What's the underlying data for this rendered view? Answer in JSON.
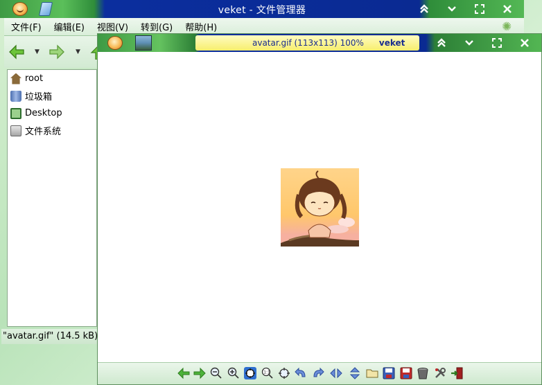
{
  "file_manager": {
    "title": "veket - 文件管理器",
    "menu": [
      "文件(F)",
      "编辑(E)",
      "视图(V)",
      "转到(G)",
      "帮助(H)"
    ],
    "sidebar": [
      {
        "label": "root",
        "icon": "home-icon"
      },
      {
        "label": "垃圾箱",
        "icon": "trash-icon"
      },
      {
        "label": "Desktop",
        "icon": "desktop-icon"
      },
      {
        "label": "文件系统",
        "icon": "filesystem-icon"
      }
    ],
    "status": "\"avatar.gif\" (14.5 kB)"
  },
  "image_viewer": {
    "caption_file": "avatar.gif  (113x113)  100%",
    "caption_user": "veket",
    "toolbar_icons": [
      "previous-icon",
      "next-icon",
      "zoom-out-icon",
      "zoom-in-icon",
      "zoom-fit-icon",
      "zoom-100-icon",
      "fullscreen-icon",
      "rotate-left-icon",
      "rotate-right-icon",
      "flip-horizontal-icon",
      "flip-vertical-icon",
      "open-folder-icon",
      "save-icon",
      "save-as-icon",
      "delete-icon",
      "settings-icon",
      "exit-icon"
    ]
  },
  "window_buttons": {
    "shade": "⌃",
    "minimize": "⌄",
    "maximize": "⛶",
    "close": "✕"
  },
  "colors": {
    "title_blue": "#0b2e9e",
    "caption_yellow": "#f7ee6c",
    "accent_green": "#3aa33a"
  }
}
